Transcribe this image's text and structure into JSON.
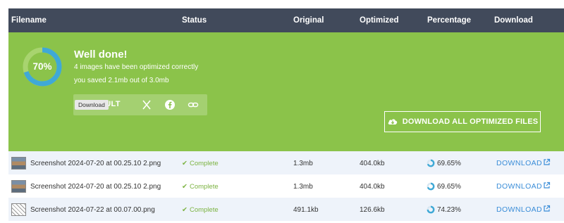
{
  "columns": {
    "filename": "Filename",
    "status": "Status",
    "original": "Original",
    "optimized": "Optimized",
    "percentage": "Percentage",
    "download": "Download"
  },
  "summary": {
    "percent_label": "70%",
    "percent_value": 0.7,
    "title": "Well done!",
    "line1": "4 images have been optimized correctly",
    "line2": "you saved 2.1mb out of 3.0mb",
    "share_label": "ESULT",
    "tooltip": "Download",
    "download_all": "DOWNLOAD ALL OPTIMIZED FILES"
  },
  "rows": [
    {
      "filename": "Screenshot 2024-07-20 at 00.25.10 2.png",
      "status": "Complete",
      "original": "1.3mb",
      "optimized": "404.0kb",
      "percentage": "69.65%",
      "download": "DOWNLOAD"
    },
    {
      "filename": "Screenshot 2024-07-20 at 00.25.10 2.png",
      "status": "Complete",
      "original": "1.3mb",
      "optimized": "404.0kb",
      "percentage": "69.65%",
      "download": "DOWNLOAD"
    },
    {
      "filename": "Screenshot 2024-07-22 at 00.07.00.png",
      "status": "Complete",
      "original": "491.1kb",
      "optimized": "126.6kb",
      "percentage": "74.23%",
      "download": "DOWNLOAD"
    }
  ],
  "colors": {
    "header_bg": "#414a5b",
    "success_bg": "#8bc34a",
    "ring": "#3fa9d6",
    "complete": "#7cb342",
    "link": "#3a8dd8"
  },
  "icons": {
    "twitter": "x-icon",
    "facebook": "facebook-icon",
    "link": "link-icon",
    "cloud": "cloud-download-icon",
    "external": "external-link-icon"
  }
}
